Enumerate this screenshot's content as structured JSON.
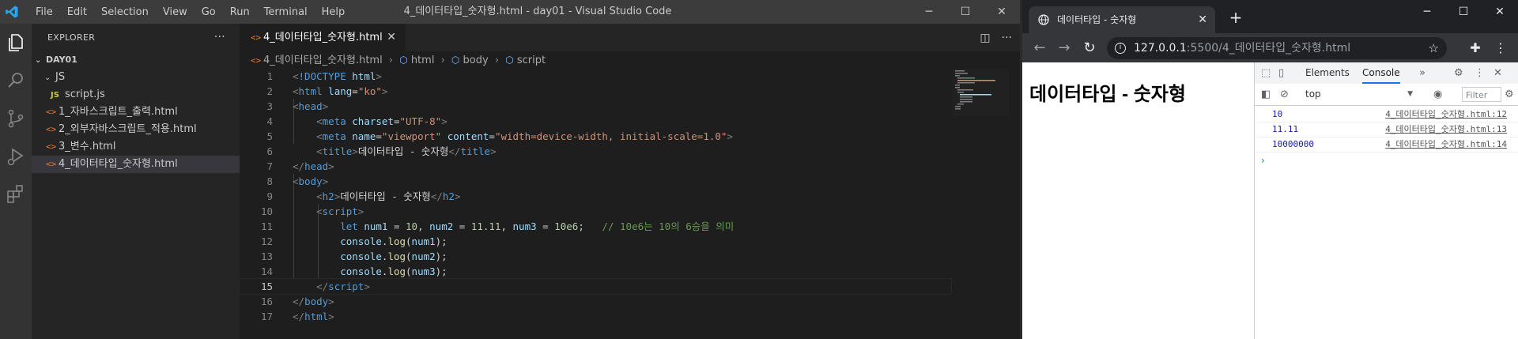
{
  "vscode": {
    "menu": [
      "File",
      "Edit",
      "Selection",
      "View",
      "Go",
      "Run",
      "Terminal",
      "Help"
    ],
    "window_title": "4_데이터타입_숫자형.html - day01 - Visual Studio Code",
    "explorer": {
      "title": "EXPLORER",
      "more": "···",
      "folder": "DAY01",
      "subfolder": "JS",
      "subfile": "script.js",
      "files": [
        "1_자바스크립트_출력.html",
        "2_외부자바스크립트_적용.html",
        "3_변수.html",
        "4_데이터타입_숫자형.html"
      ]
    },
    "tab_label": "4_데이터타입_숫자형.html",
    "breadcrumbs": [
      "4_데이터타입_숫자형.html",
      "html",
      "body",
      "script"
    ],
    "active_line": 15,
    "line_numbers": [
      "1",
      "2",
      "3",
      "4",
      "5",
      "6",
      "7",
      "8",
      "9",
      "10",
      "11",
      "12",
      "13",
      "14",
      "15",
      "16",
      "17"
    ],
    "code": {
      "doctype": "!DOCTYPE",
      "html": "html",
      "lang_attr": "lang",
      "lang_val": "\"ko\"",
      "head": "head",
      "meta": "meta",
      "charset_attr": "charset",
      "charset_val": "\"UTF-8\"",
      "name_attr": "name",
      "name_val": "\"viewport\"",
      "content_attr": "content",
      "content_val": "\"width=device-width, initial-scale=1.0\"",
      "title": "title",
      "title_text": "데이터타입 - 숫자형",
      "body": "body",
      "h2": "h2",
      "h2_text": "데이터타입 - 숫자형",
      "script": "script",
      "let": "let",
      "num1": "num1",
      "num2": "num2",
      "num3": "num3",
      "v1": "10",
      "v2": "11.11",
      "v3": "10e6",
      "comment": "// 10e6는 10의 6승을 의미",
      "console": "console",
      "log": "log"
    }
  },
  "chrome": {
    "tab_title": "데이터타입 - 숫자형",
    "url_host": "127.0.0.1",
    "url_path": ":5500/4_데이터타입_숫자형.html",
    "page_heading": "데이터타입 - 숫자형",
    "devtools": {
      "tabs": [
        "Elements",
        "Console"
      ],
      "active_tab": "Console",
      "context": "top",
      "filter_placeholder": "Filter",
      "logs": [
        {
          "value": "10",
          "source": "4_데이터타입_숫자형.html:12"
        },
        {
          "value": "11.11",
          "source": "4_데이터타입_숫자형.html:13"
        },
        {
          "value": "10000000",
          "source": "4_데이터타입_숫자형.html:14"
        }
      ],
      "prompt": "›"
    }
  }
}
